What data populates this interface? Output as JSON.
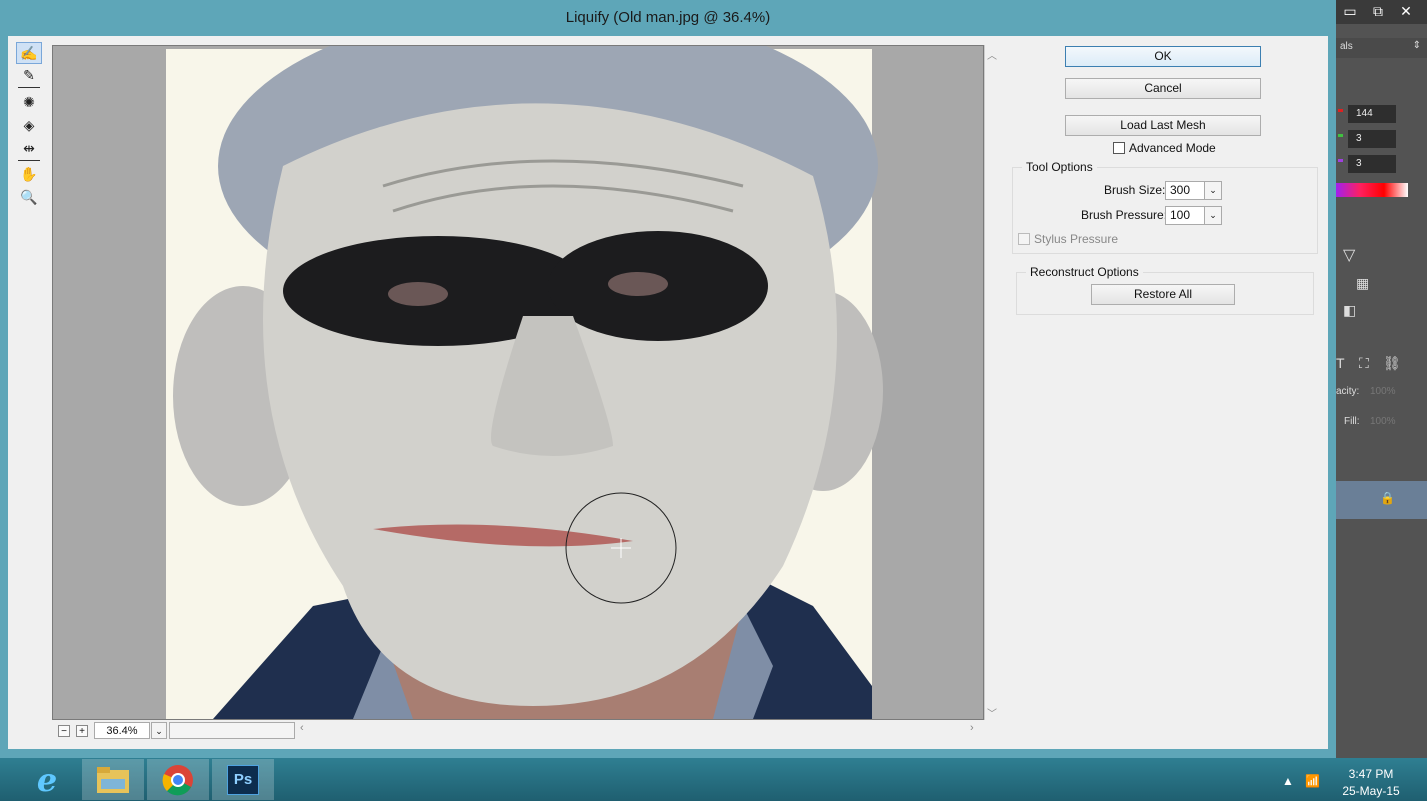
{
  "dialog": {
    "title": "Liquify (Old man.jpg @ 36.4%)"
  },
  "tools": [
    {
      "name": "forward-warp-tool-icon",
      "glyph": "✍"
    },
    {
      "name": "reconstruct-tool-icon",
      "glyph": "✎"
    },
    {
      "name": "pucker-tool-icon",
      "glyph": "✺"
    },
    {
      "name": "bloat-tool-icon",
      "glyph": "◈"
    },
    {
      "name": "push-left-tool-icon",
      "glyph": "⇹"
    },
    {
      "name": "hand-tool-icon",
      "glyph": "✋"
    },
    {
      "name": "zoom-tool-icon",
      "glyph": "🔍"
    }
  ],
  "zoom": {
    "minus_label": "−",
    "plus_label": "+",
    "value": "36.4%",
    "dropdown_glyph": "⌄"
  },
  "buttons": {
    "ok": "OK",
    "cancel": "Cancel",
    "load_last_mesh": "Load Last Mesh",
    "restore_all": "Restore All"
  },
  "advanced_mode": {
    "label": "Advanced Mode",
    "checked": false
  },
  "tool_options": {
    "legend": "Tool Options",
    "brush_size_label": "Brush Size:",
    "brush_size_value": "300",
    "brush_pressure_label": "Brush Pressure:",
    "brush_pressure_value": "100",
    "stylus_pressure_label": "Stylus Pressure"
  },
  "reconstruct_options": {
    "legend": "Reconstruct Options"
  },
  "photoshop_panel": {
    "window_controls": [
      "▭",
      "⧉",
      "✕"
    ],
    "dropdown_text": "als",
    "fields": [
      "144",
      "3",
      "3"
    ],
    "opacity_label": "acity:",
    "opacity_value": "100%",
    "fill_label": "Fill:",
    "fill_value": "100%",
    "colors": {
      "red": "#e02020",
      "green": "#40c040",
      "purple": "#a040e0"
    }
  },
  "taskbar": {
    "apps": [
      {
        "name": "internet-explorer-icon",
        "label": "e"
      },
      {
        "name": "file-explorer-icon",
        "label": ""
      },
      {
        "name": "chrome-icon",
        "label": ""
      },
      {
        "name": "photoshop-icon",
        "label": "Ps"
      }
    ],
    "time": "3:47 PM",
    "date": "25-May-15"
  }
}
